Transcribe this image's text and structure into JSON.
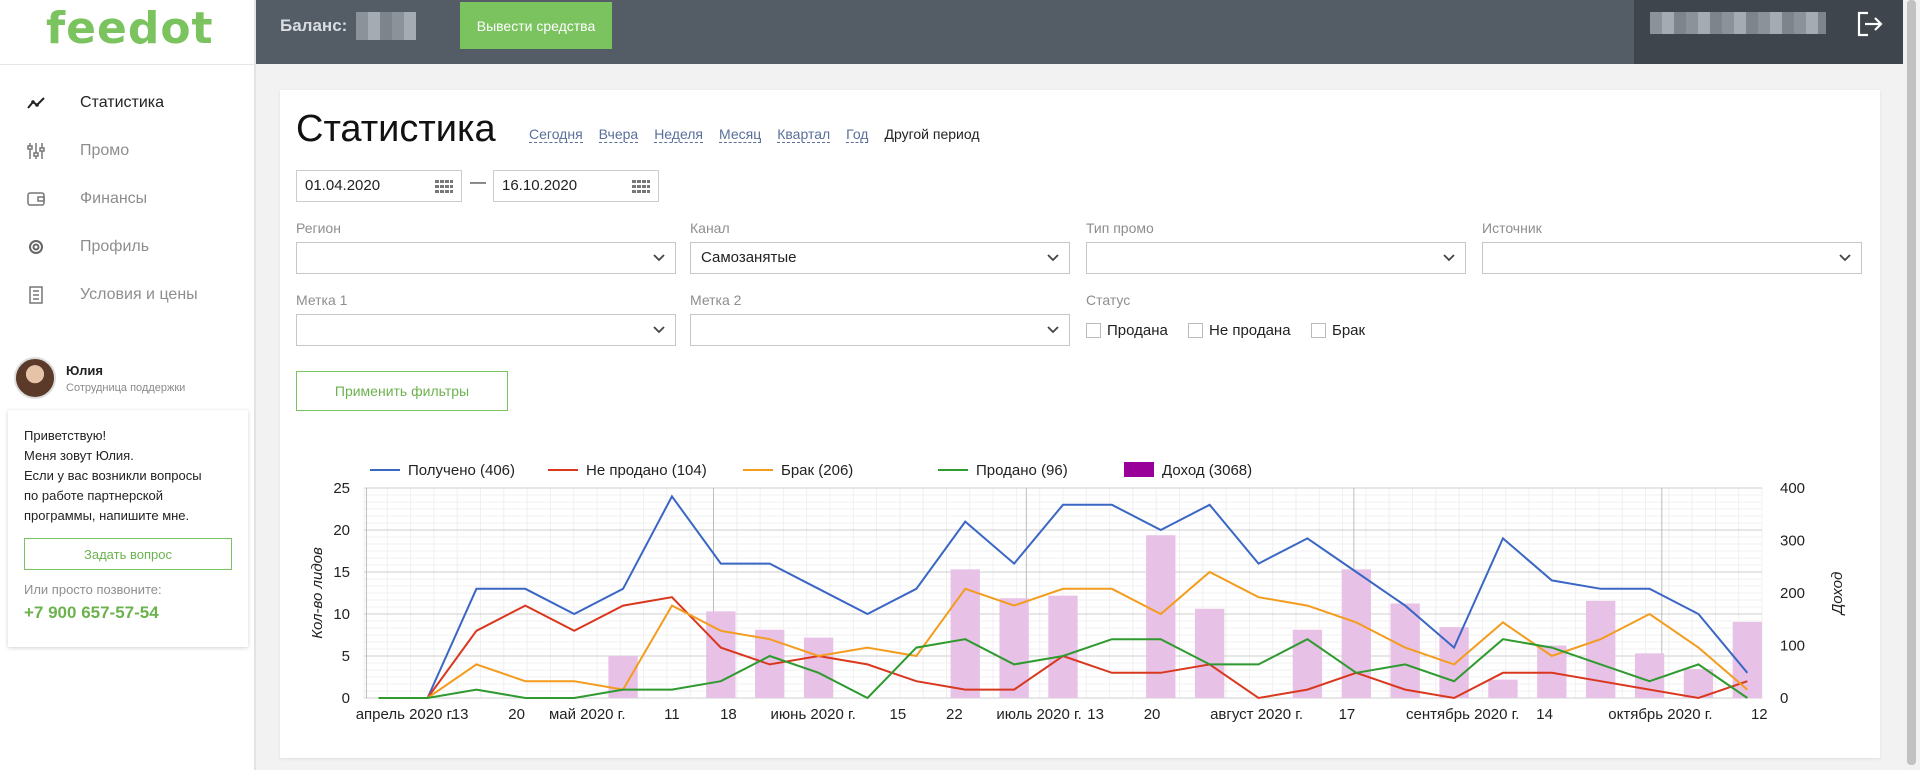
{
  "brand": {
    "logo": "feedot",
    "accent": "#7bc35f"
  },
  "sidebar": {
    "items": [
      {
        "label": "Статистика",
        "icon": "line-chart-icon",
        "active": true
      },
      {
        "label": "Промо",
        "icon": "sliders-icon",
        "active": false
      },
      {
        "label": "Финансы",
        "icon": "wallet-icon",
        "active": false
      },
      {
        "label": "Профиль",
        "icon": "gear-icon",
        "active": false
      },
      {
        "label": "Условия и цены",
        "icon": "document-icon",
        "active": false
      }
    ]
  },
  "support": {
    "name": "Юлия",
    "role": "Сотрудница поддержки",
    "message": "Приветствую!\nМеня зовут Юлия.\nЕсли у вас возникли вопросы\nпо работе партнерской\nпрограммы, напишите мне.",
    "ask_button": "Задать вопрос",
    "call_hint": "Или просто позвоните:",
    "phone": "+7 900 657-57-54"
  },
  "topbar": {
    "balance_label": "Баланс:",
    "withdraw_button": "Вывести средства"
  },
  "page": {
    "title": "Статистика",
    "periods": [
      "Сегодня",
      "Вчера",
      "Неделя",
      "Месяц",
      "Квартал",
      "Год"
    ],
    "period_current": "Другой период",
    "date_from": "01.04.2020",
    "date_dash": "—",
    "date_to": "16.10.2020"
  },
  "filters": {
    "region": {
      "label": "Регион",
      "value": ""
    },
    "channel": {
      "label": "Канал",
      "value": "Самозанятые"
    },
    "promo_type": {
      "label": "Тип промо",
      "value": ""
    },
    "source": {
      "label": "Источник",
      "value": ""
    },
    "tag1": {
      "label": "Метка 1",
      "value": ""
    },
    "tag2": {
      "label": "Метка 2",
      "value": ""
    },
    "status": {
      "label": "Статус",
      "options": [
        "Продана",
        "Не продана",
        "Брак"
      ]
    },
    "apply_button": "Применить фильтры"
  },
  "chart_data": {
    "type": "line",
    "legend_placement": "top-left",
    "grid": true,
    "ylabel": "Кол-во лидов",
    "y2label": "Доход",
    "ylim": [
      0,
      25
    ],
    "y2lim": [
      0,
      400
    ],
    "yticks": [
      0,
      5,
      10,
      15,
      20,
      25
    ],
    "y2ticks": [
      0,
      100,
      200,
      300,
      400
    ],
    "x_tick_labels": [
      "апрель 2020 г.",
      "13",
      "20",
      "май 2020 г.",
      "11",
      "18",
      "июнь 2020 г.",
      "15",
      "22",
      "июль 2020 г.",
      "13",
      "20",
      "август 2020 г.",
      "17",
      "сентябрь 2020 г.",
      "14",
      "октябрь 2020 г.",
      "12"
    ],
    "series": [
      {
        "name": "Получено (406)",
        "color": "#3a66c4",
        "values": [
          0,
          0,
          13,
          13,
          10,
          13,
          24,
          16,
          16,
          13,
          10,
          13,
          21,
          16,
          23,
          23,
          20,
          23,
          16,
          19,
          15,
          11,
          6,
          19,
          14,
          13,
          13,
          10,
          3
        ]
      },
      {
        "name": "Не продано (104)",
        "color": "#d9381e",
        "values": [
          0,
          0,
          8,
          11,
          8,
          11,
          12,
          6,
          4,
          5,
          4,
          2,
          1,
          1,
          5,
          3,
          3,
          4,
          0,
          1,
          3,
          1,
          0,
          3,
          3,
          2,
          1,
          0,
          2
        ]
      },
      {
        "name": "Брак (206)",
        "color": "#f39c1e",
        "values": [
          0,
          0,
          4,
          2,
          2,
          1,
          11,
          8,
          7,
          5,
          6,
          5,
          13,
          11,
          13,
          13,
          10,
          15,
          12,
          11,
          9,
          6,
          4,
          9,
          5,
          7,
          10,
          6,
          1
        ]
      },
      {
        "name": "Продано (96)",
        "color": "#2f9a2f",
        "values": [
          0,
          0,
          1,
          0,
          0,
          1,
          1,
          2,
          5,
          3,
          0,
          6,
          7,
          4,
          5,
          7,
          7,
          4,
          4,
          7,
          3,
          4,
          2,
          7,
          6,
          4,
          2,
          4,
          0
        ]
      }
    ],
    "bars": {
      "name": "Доход (3068)",
      "color": "#e7c1e6",
      "legend_color": "#990099",
      "values": [
        0,
        0,
        0,
        0,
        0,
        80,
        0,
        165,
        130,
        115,
        0,
        0,
        245,
        190,
        195,
        0,
        310,
        170,
        0,
        130,
        245,
        180,
        135,
        35,
        100,
        185,
        85,
        55,
        145
      ]
    }
  }
}
